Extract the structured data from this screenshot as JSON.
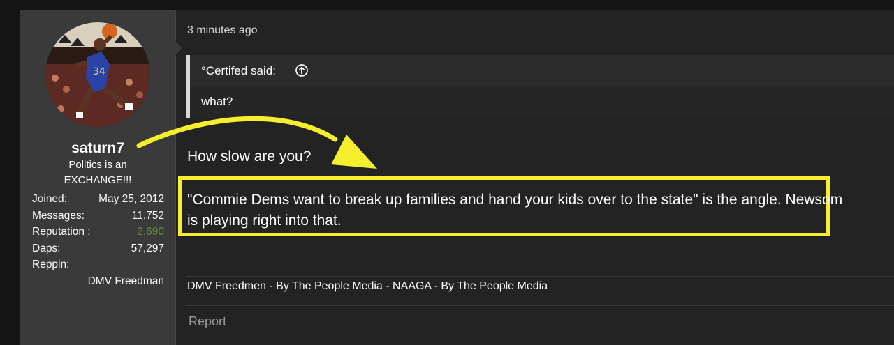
{
  "post": {
    "timestamp": "3 minutes ago",
    "quote": {
      "author": "°Certifed said:",
      "text": "what?"
    },
    "message": {
      "line1": "How slow are you?",
      "highlighted": "\"Commie Dems want to break up families and hand your kids over to the state\" is the angle. Newsom is playing right into that."
    },
    "signature": "DMV Freedmen - By The People Media - NAAGA - By The People Media",
    "report_label": "Report"
  },
  "user": {
    "name": "saturn7",
    "title": "Politics is an EXCHANGE!!!",
    "stats": [
      {
        "label": "Joined:",
        "value": "May 25, 2012"
      },
      {
        "label": "Messages:",
        "value": "11,752"
      },
      {
        "label": "Reputation :",
        "value": "2,690"
      },
      {
        "label": "Daps:",
        "value": "57,297"
      },
      {
        "label": "Reppin:",
        "value": ""
      }
    ],
    "reppin": "DMV Freedman"
  },
  "colors": {
    "annotation": "#f7ee2e",
    "reputation": "#5f8f3d",
    "panel_bg": "#3a3a3a",
    "post_bg": "#232323"
  },
  "icons": {
    "quote_jump": "arrow-up-circle-icon",
    "annotation_arrow": "curved-arrow-icon"
  }
}
